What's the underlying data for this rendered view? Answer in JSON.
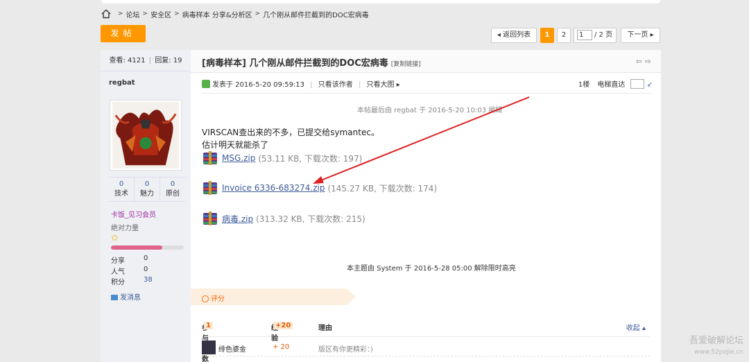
{
  "breadcrumb": {
    "items": [
      "论坛",
      "安全区",
      "病毒样本 分享&分析区",
      "几个刚从邮件拦截到的DOC宏病毒"
    ],
    "separator": ">"
  },
  "post_button": "发帖",
  "pager": {
    "back": "◂ 返回列表",
    "pages": [
      "1",
      "2"
    ],
    "current": "1",
    "input_value": "1",
    "total": "/ 2 页",
    "next": "下一页 ▸"
  },
  "stats": {
    "views_label": "查看:",
    "views": "4121",
    "replies_label": "回复:",
    "replies": "19"
  },
  "user": {
    "name": "regbat",
    "counters": [
      {
        "value": "0",
        "label": "技术"
      },
      {
        "value": "0",
        "label": "魅力"
      },
      {
        "value": "0",
        "label": "原创"
      }
    ],
    "group": "卡饭_见习会员",
    "title": "绝对力量",
    "star": "✩",
    "progress": 0.7,
    "share_label": "分享",
    "share": "0",
    "pop_label": "人气",
    "pop": "0",
    "points_label": "积分",
    "points": "38",
    "message": "发消息"
  },
  "thread": {
    "title": "[病毒样本] 几个刚从邮件拦截到的DOC宏病毒",
    "copy_link": "[复制链接]",
    "nav_arrows": "⇦ ⇨"
  },
  "post": {
    "posted": "发表于 2016-5-20 09:59:13",
    "only_author": "只看该作者",
    "only_big": "只看大图 ▸",
    "floor": "1楼",
    "direct": "电梯直达",
    "edited": "本帖最后由 regbat 于 2016-5-20 10:03 编辑",
    "lines": [
      "VIRSCAN查出来的不多，已提交给symantec。",
      "估计明天就能杀了"
    ],
    "attachments": [
      {
        "name": "MSG.zip",
        "info": "(53.11 KB, 下载次数: 197)"
      },
      {
        "name": "Invoice 6336-683274.zip",
        "info": "(145.27 KB, 下载次数: 174)"
      },
      {
        "name": "病毒.zip",
        "info": "(313.32 KB, 下载次数: 215)"
      }
    ],
    "closed_note": "本主题由 System 于 2016-5-28 05:00 解除限时高亮"
  },
  "rating": {
    "label": "评分",
    "participants_label": "参与人数",
    "participants": "1",
    "exp_label": "经验",
    "exp_total": "+20",
    "reason_label": "理由",
    "collapse": "收起 ▴",
    "rows": [
      {
        "user": "绯色婆金",
        "exp": "+ 20",
        "reason": "版区有你更精彩：)"
      }
    ]
  },
  "watermark": {
    "name": "吾爱破解论坛",
    "url": "www.52pojie.cn"
  },
  "colors": {
    "accent": "#ff9800",
    "link": "#3b5a9a",
    "annotation_arrow": "#e02020"
  }
}
